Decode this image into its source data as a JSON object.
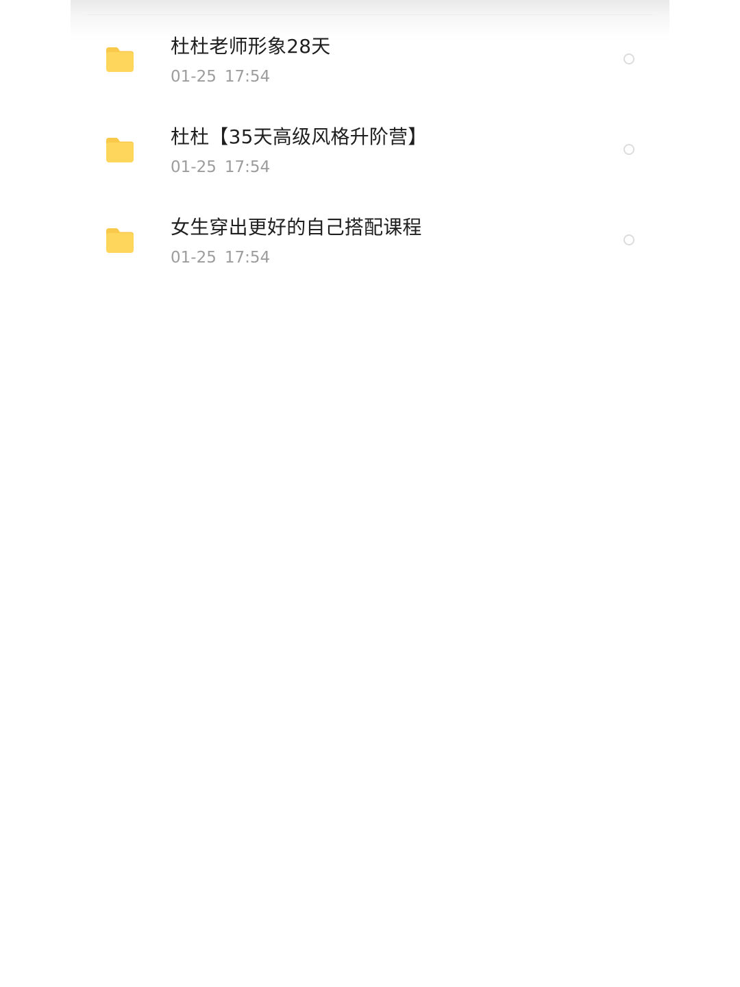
{
  "file_list": {
    "items": [
      {
        "name": "杜杜老师形象28天",
        "date": "01-25",
        "time": "17:54",
        "icon": "folder-icon",
        "selected": false
      },
      {
        "name": "杜杜【35天高级风格升阶营】",
        "date": "01-25",
        "time": "17:54",
        "icon": "folder-icon",
        "selected": false
      },
      {
        "name": "女生穿出更好的自己搭配课程",
        "date": "01-25",
        "time": "17:54",
        "icon": "folder-icon",
        "selected": false
      }
    ]
  },
  "colors": {
    "folder": "#FFD65C",
    "folder_tab": "#F8C94A",
    "title_text": "#1F1F1F",
    "meta_text": "#9C9C9C",
    "radio_border": "#DCDCDC"
  }
}
